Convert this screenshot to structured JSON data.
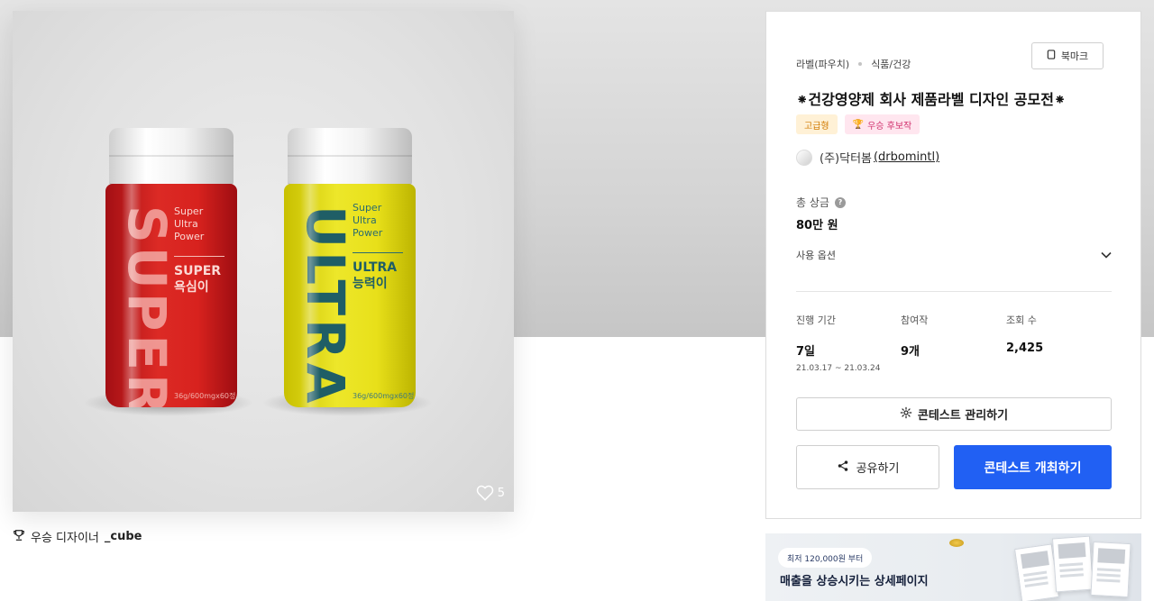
{
  "product": {
    "likes": "5",
    "red_bottle": {
      "big_word": "SUPER",
      "tagline": [
        "Super",
        "Ultra",
        "Power"
      ],
      "sub_name_1": "SUPER",
      "sub_name_2": "욕심이",
      "size": "36g/600mgx60정"
    },
    "yellow_bottle": {
      "big_word": "ULTRA",
      "tagline": [
        "Super",
        "Ultra",
        "Power"
      ],
      "sub_name_1": "ULTRA",
      "sub_name_2": "능력이",
      "size": "36g/600mgx60정"
    }
  },
  "winner": {
    "label": "우승 디자이너",
    "name": "_cube"
  },
  "panel": {
    "category_1": "라벨(파우치)",
    "category_2": "식품/건강",
    "bookmark_label": "북마크",
    "title": "⁕건강영양제 회사 제품라벨 디자인 공모전⁕",
    "badge_tier": "고급형",
    "badge_award": "우승 후보작",
    "host_name": "(주)닥터봄",
    "host_id": "(drbomintl)",
    "prize_label": "총 상금",
    "prize_value": "80만 원",
    "options_label": "사용 옵션",
    "stats": {
      "period_label": "진행 기간",
      "period_value": "7일",
      "period_range": "21.03.17 ~ 21.03.24",
      "entries_label": "참여작",
      "entries_value": "9개",
      "views_label": "조회 수",
      "views_value": "2,425"
    },
    "manage_label": "콘테스트 관리하기",
    "share_label": "공유하기",
    "host_button_label": "콘테스트 개최하기"
  },
  "ad": {
    "pill": "최저 120,000원 부터",
    "headline": "매출을 상승시키는 상세페이지"
  },
  "colors": {
    "primary": "#2160f3",
    "red_bottle": "#d8221e",
    "yellow_bottle": "#e8e01a",
    "badge_tier_bg": "#fff1d6",
    "badge_award_bg": "#ffe6ef"
  }
}
